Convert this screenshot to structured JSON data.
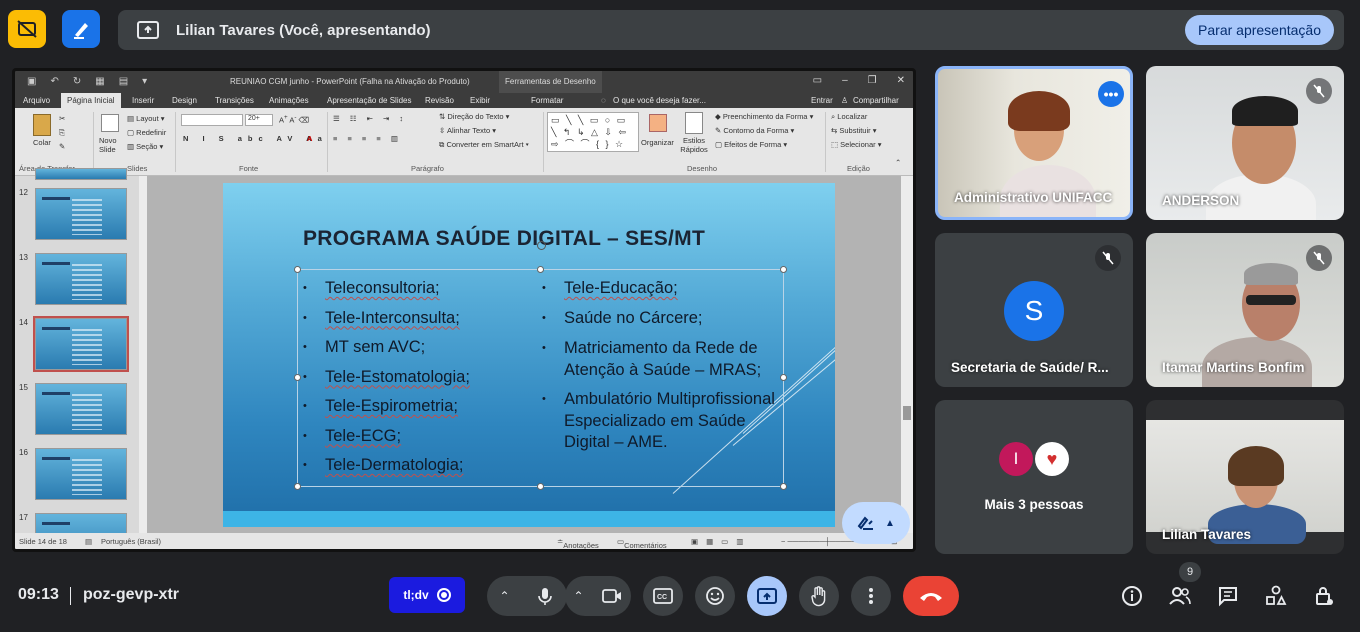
{
  "meeting": {
    "presenter_banner": "Lilian Tavares (Você, apresentando)",
    "stop_presenting": "Parar apresentação",
    "time": "09:13",
    "code": "poz-gevp-xtr",
    "extension_label": "tl;dv",
    "participant_count": "9"
  },
  "powerpoint": {
    "window_title": "REUNIAO CGM junho - PowerPoint (Falha na Ativação do Produto)",
    "contextual_tab": "Ferramentas de Desenho",
    "tabs": [
      "Arquivo",
      "Página Inicial",
      "Inserir",
      "Design",
      "Transições",
      "Animações",
      "Apresentação de Slides",
      "Revisão",
      "Exibir",
      "Formatar"
    ],
    "search_placeholder": "O que você deseja fazer...",
    "enter": "Entrar",
    "share": "Compartilhar",
    "ribbon": {
      "paste": "Colar",
      "clipboard": "Área de Transfer...",
      "new_slide": "Novo Slide",
      "layout": "Layout",
      "reset": "Redefinir",
      "section": "Seção",
      "slides": "Slides",
      "font_size": "20+",
      "font": "Fonte",
      "text_direction": "Direção do Texto",
      "align_text": "Alinhar Texto",
      "smartart": "Converter em SmartArt",
      "paragraph": "Parágrafo",
      "arrange": "Organizar",
      "quick_styles": "Estilos Rápidos",
      "shape_fill": "Preenchimento da Forma",
      "shape_outline": "Contorno da Forma",
      "shape_effects": "Efeitos de Forma",
      "drawing": "Desenho",
      "find": "Localizar",
      "replace": "Substituir",
      "select": "Selecionar",
      "editing": "Edição"
    },
    "thumb_numbers": [
      "12",
      "13",
      "14",
      "15",
      "16",
      "17"
    ],
    "status_slide": "Slide 14 de 18",
    "status_language": "Português (Brasil)",
    "status_notes": "Anotações",
    "status_comments": "Comentários"
  },
  "slide": {
    "title": "PROGRAMA SAÚDE DIGITAL – SES/MT",
    "left_items": [
      "Teleconsultoria;",
      "Tele-Interconsulta;",
      "MT sem AVC;",
      "Tele-Estomatologia;",
      "Tele-Espirometria;",
      "Tele-ECG;",
      "Tele-Dermatologia;"
    ],
    "right_items": [
      "Tele-Educação;",
      "Saúde no Cárcere;",
      "Matriciamento da Rede de Atenção à Saúde – MRAS;",
      "Ambulatório Multiprofissional Especializado em Saúde Digital – AME."
    ]
  },
  "participants": [
    {
      "name": "Administrativo UNIFACC",
      "speaking": true
    },
    {
      "name": "ANDERSON",
      "muted": true
    },
    {
      "name": "Secretaria de Saúde/ R...",
      "initial": "S",
      "avatar_color": "#1a73e8",
      "muted": true
    },
    {
      "name": "Itamar Martins Bonfim",
      "muted": true
    },
    {
      "name": "Mais 3 pessoas",
      "initial": "I",
      "avatar_color": "#c2185b"
    },
    {
      "name": "Lilian Tavares"
    }
  ],
  "colors": {
    "background": "#202124",
    "accent": "#a8c7fa",
    "end_call": "#ea4335",
    "present_active": "#a8c7fa"
  }
}
